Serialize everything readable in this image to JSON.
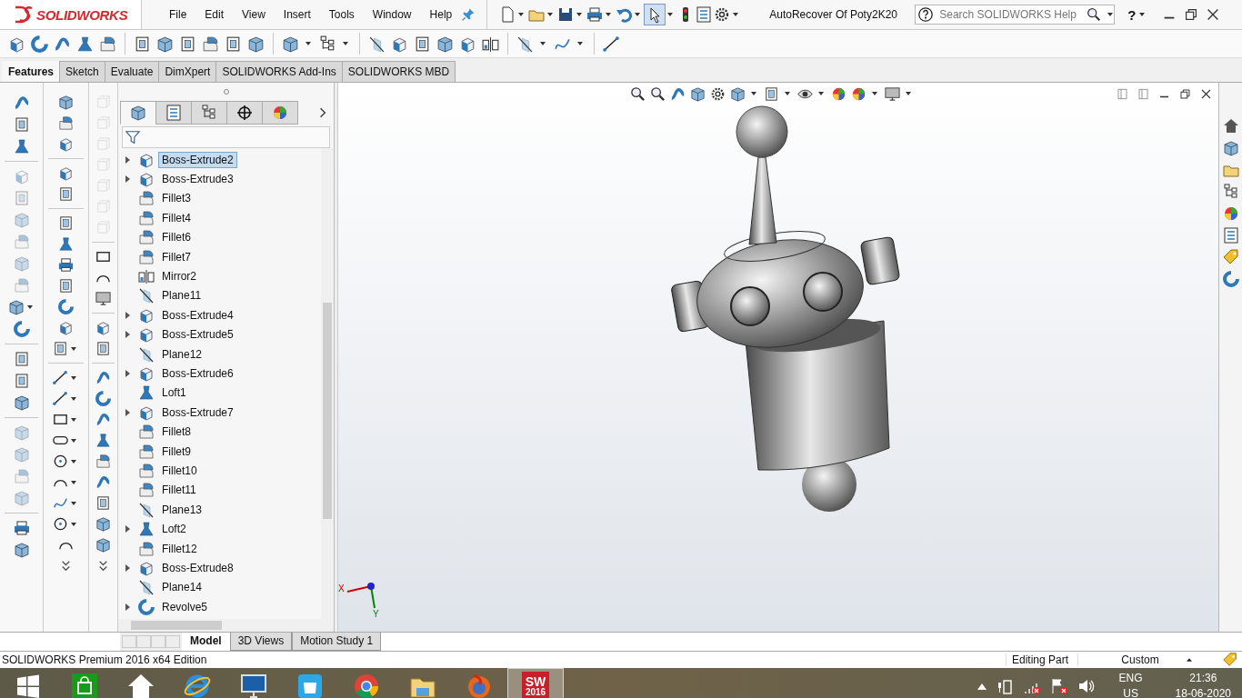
{
  "logo": {
    "text": "SOLIDWORKS"
  },
  "menu": [
    "File",
    "Edit",
    "View",
    "Insert",
    "Tools",
    "Window",
    "Help"
  ],
  "select_tool": {
    "selected": true
  },
  "document_title": "AutoRecover Of Poty2K20",
  "search": {
    "placeholder": "Search SOLIDWORKS Help"
  },
  "help_button": "?",
  "command_tabs": [
    {
      "label": "Features",
      "selected": true
    },
    {
      "label": "Sketch",
      "selected": false
    },
    {
      "label": "Evaluate",
      "selected": false
    },
    {
      "label": "DimXpert",
      "selected": false
    },
    {
      "label": "SOLIDWORKS Add-Ins",
      "selected": false
    },
    {
      "label": "SOLIDWORKS MBD",
      "selected": false
    }
  ],
  "panel_tabs": [
    {
      "kind": "feature-tree",
      "selected": true
    },
    {
      "kind": "property",
      "selected": false
    },
    {
      "kind": "configuration",
      "selected": false
    },
    {
      "kind": "dimxpert",
      "selected": false
    },
    {
      "kind": "display",
      "selected": false
    }
  ],
  "feature_tree": [
    {
      "name": "Boss-Extrude2",
      "kind": "boss",
      "expandable": true,
      "selected": true
    },
    {
      "name": "Boss-Extrude3",
      "kind": "boss",
      "expandable": true,
      "selected": false
    },
    {
      "name": "Fillet3",
      "kind": "fillet",
      "expandable": false,
      "selected": false
    },
    {
      "name": "Fillet4",
      "kind": "fillet",
      "expandable": false,
      "selected": false
    },
    {
      "name": "Fillet6",
      "kind": "fillet",
      "expandable": false,
      "selected": false
    },
    {
      "name": "Fillet7",
      "kind": "fillet",
      "expandable": false,
      "selected": false
    },
    {
      "name": "Mirror2",
      "kind": "mirror",
      "expandable": false,
      "selected": false
    },
    {
      "name": "Plane11",
      "kind": "plane",
      "expandable": false,
      "selected": false
    },
    {
      "name": "Boss-Extrude4",
      "kind": "boss",
      "expandable": true,
      "selected": false
    },
    {
      "name": "Boss-Extrude5",
      "kind": "boss",
      "expandable": true,
      "selected": false
    },
    {
      "name": "Plane12",
      "kind": "plane",
      "expandable": false,
      "selected": false
    },
    {
      "name": "Boss-Extrude6",
      "kind": "boss",
      "expandable": true,
      "selected": false
    },
    {
      "name": "Loft1",
      "kind": "loft",
      "expandable": false,
      "selected": false
    },
    {
      "name": "Boss-Extrude7",
      "kind": "boss",
      "expandable": true,
      "selected": false
    },
    {
      "name": "Fillet8",
      "kind": "fillet",
      "expandable": false,
      "selected": false
    },
    {
      "name": "Fillet9",
      "kind": "fillet",
      "expandable": false,
      "selected": false
    },
    {
      "name": "Fillet10",
      "kind": "fillet",
      "expandable": false,
      "selected": false
    },
    {
      "name": "Fillet11",
      "kind": "fillet",
      "expandable": false,
      "selected": false
    },
    {
      "name": "Plane13",
      "kind": "plane",
      "expandable": false,
      "selected": false
    },
    {
      "name": "Loft2",
      "kind": "loft",
      "expandable": true,
      "selected": false
    },
    {
      "name": "Fillet12",
      "kind": "fillet",
      "expandable": false,
      "selected": false
    },
    {
      "name": "Boss-Extrude8",
      "kind": "boss",
      "expandable": true,
      "selected": false
    },
    {
      "name": "Plane14",
      "kind": "plane",
      "expandable": false,
      "selected": false
    },
    {
      "name": "Revolve5",
      "kind": "revolve",
      "expandable": true,
      "selected": false
    }
  ],
  "triad": {
    "x_label": "X",
    "y_label": "Y"
  },
  "bottom_tabs": [
    {
      "label": "Model",
      "selected": true
    },
    {
      "label": "3D Views",
      "selected": false
    },
    {
      "label": "Motion Study 1",
      "selected": false
    }
  ],
  "status_bar": {
    "edition": "SOLIDWORKS Premium 2016 x64 Edition",
    "mode": "Editing Part",
    "units": "Custom"
  },
  "taskbar": {
    "apps": [
      {
        "kind": "store",
        "selected": false
      },
      {
        "kind": "home",
        "selected": false
      },
      {
        "kind": "browser-e",
        "selected": false
      },
      {
        "kind": "monitor",
        "selected": false
      },
      {
        "kind": "bag",
        "selected": false
      },
      {
        "kind": "chrome",
        "selected": false
      },
      {
        "kind": "folder",
        "selected": false
      },
      {
        "kind": "firefox",
        "selected": false
      },
      {
        "kind": "solidworks",
        "selected": true
      }
    ],
    "badge_letters": "SW",
    "badge_year": "2016",
    "language": "ENG",
    "region": "US",
    "time": "21:36",
    "date": "18-06-2020"
  }
}
